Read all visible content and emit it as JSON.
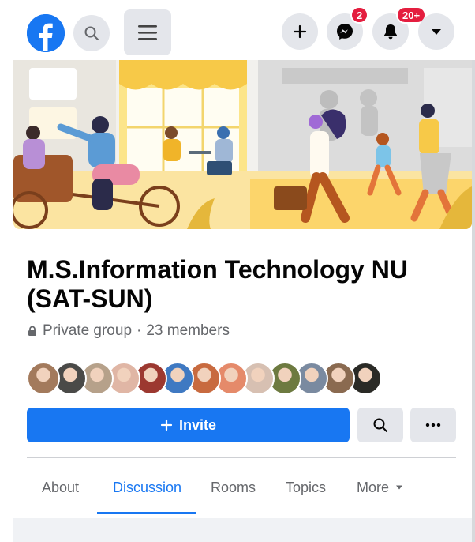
{
  "topbar": {
    "messenger_badge": "2",
    "notifications_badge": "20+"
  },
  "group": {
    "name": "M.S.Information Technology NU (SAT-SUN)",
    "privacy": "Private group",
    "separator": "·",
    "members": "23 members",
    "member_avatar_colors": [
      "#a37a5c",
      "#4a4a48",
      "#b6a18a",
      "#e0b6a5",
      "#9c3830",
      "#3f79c2",
      "#c86a3f",
      "#e58a6a",
      "#d7c0b2",
      "#6d7a40",
      "#7a8aa0",
      "#8a6a50",
      "#2a2a26"
    ]
  },
  "actions": {
    "invite_label": "Invite"
  },
  "tabs": [
    {
      "label": "About"
    },
    {
      "label": "Discussion"
    },
    {
      "label": "Rooms"
    },
    {
      "label": "Topics"
    },
    {
      "label": "More"
    }
  ],
  "colors": {
    "brand": "#1877f2",
    "badge": "#e41e3f",
    "button_gray": "#e4e6eb"
  }
}
